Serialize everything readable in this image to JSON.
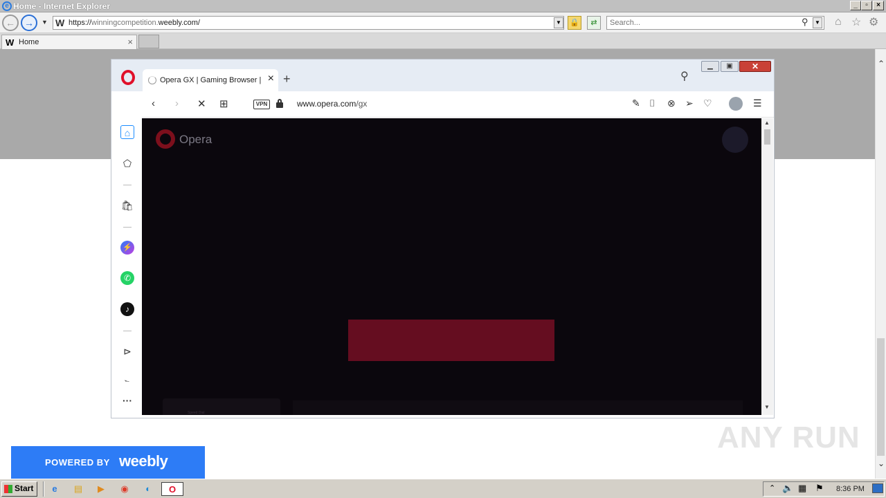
{
  "ie": {
    "title": "Home - Internet Explorer",
    "address": {
      "prefix": "https://",
      "sub": "winningcompetition.",
      "domain": "weebly.com/"
    },
    "search_placeholder": "Search...",
    "tab_label": "Home"
  },
  "opera": {
    "tab_title": "Opera GX | Gaming Browser |",
    "vpn_label": "VPN",
    "url": {
      "host": "www.opera.com",
      "path": "/gx"
    },
    "brand_text": "Opera",
    "ghost_text": "Speed Dial",
    "colors": {
      "content_bg": "#0b070d",
      "cta": "#650d20",
      "logo": "#e0102a"
    }
  },
  "weebly": {
    "powered_by": "POWERED BY",
    "brand": "weebly",
    "color": "#2d7cf6"
  },
  "watermark": "ANY RUN",
  "taskbar": {
    "start_label": "Start",
    "clock": "8:36 PM"
  }
}
